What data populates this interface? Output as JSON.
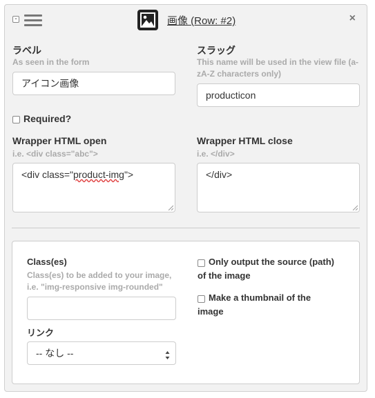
{
  "header": {
    "collapse_label": "-",
    "title": "画像 (Row: #2)",
    "close_label": "×"
  },
  "form": {
    "label_field": {
      "label": "ラベル",
      "hint": "As seen in the form",
      "value": "アイコン画像"
    },
    "slug_field": {
      "label": "スラッグ",
      "hint_line1": "This name will be used in the view file (a-",
      "hint_line2": "zA-Z characters only)",
      "value": "producticon"
    },
    "required_label": "Required?",
    "wrapper_open": {
      "label": "Wrapper HTML open",
      "hint": "i.e. <div class=\"abc\">",
      "value_prefix": "<div class=\"",
      "value_class": "product-img",
      "value_suffix": "\">"
    },
    "wrapper_close": {
      "label": "Wrapper HTML close",
      "hint": "i.e. </div>",
      "value": "</div>"
    }
  },
  "image_options": {
    "classes": {
      "label": "Class(es)",
      "hint_line1": "Class(es) to be added to your image,",
      "hint_line2": "i.e. \"img-responsive img-rounded\"",
      "value": ""
    },
    "link": {
      "label": "リンク",
      "selected": "-- なし --"
    },
    "only_source": {
      "line1": "Only output the source (path)",
      "line2": "of the image"
    },
    "thumbnail": {
      "line1": "Make a thumbnail of the",
      "line2": "image"
    }
  }
}
